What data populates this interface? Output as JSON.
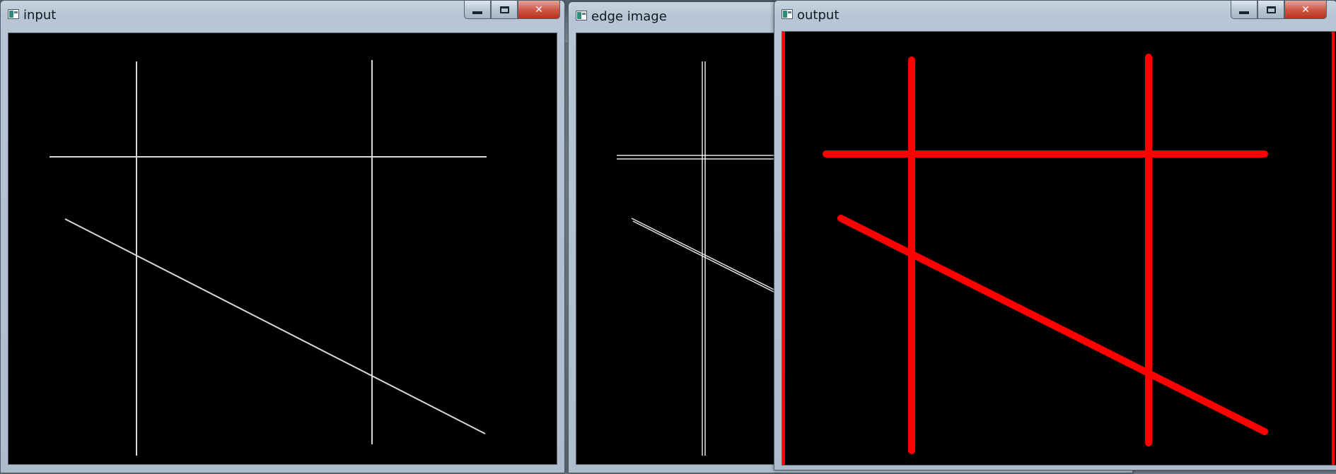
{
  "colors": {
    "canvas_bg": "#000000",
    "input_line": "#d8d8d8",
    "edge_line": "#e6e6e6",
    "output_line": "#ff0000"
  },
  "windows": [
    {
      "id": "input",
      "title": "input",
      "icon": "image-window-icon",
      "controls": [
        "minimize-icon",
        "maximize-icon",
        "close-icon"
      ]
    },
    {
      "id": "edge",
      "title": "edge image",
      "icon": "image-window-icon",
      "controls": [
        "minimize-icon",
        "maximize-icon",
        "close-icon"
      ]
    },
    {
      "id": "output",
      "title": "output",
      "icon": "image-window-icon",
      "controls": [
        "minimize-icon",
        "maximize-icon",
        "close-icon"
      ]
    }
  ]
}
